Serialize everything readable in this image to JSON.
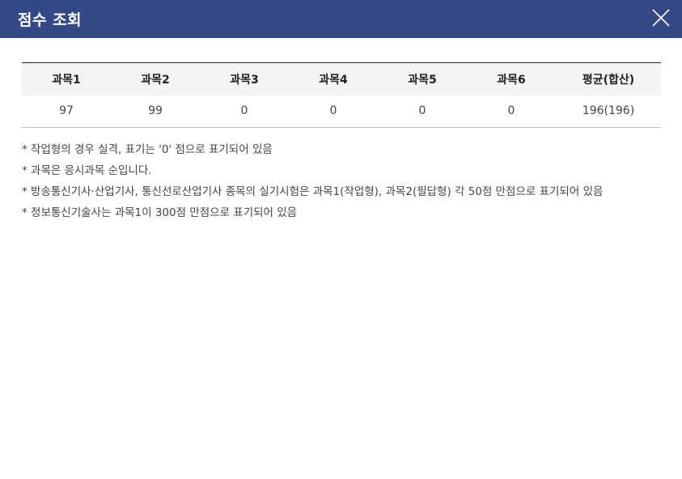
{
  "header": {
    "title": "점수 조회",
    "close_icon": "close-icon"
  },
  "table": {
    "headers": [
      "과목1",
      "과목2",
      "과목3",
      "과목4",
      "과목5",
      "과목6",
      "평균(합산)"
    ],
    "rows": [
      [
        "97",
        "99",
        "0",
        "0",
        "0",
        "0",
        "196(196)"
      ]
    ]
  },
  "notes": [
    "* 작업형의 경우 실격, 표기는 '0' 점으로 표기되어 있음",
    "* 과목은 응시과목 순입니다.",
    "* 방송통신기사·산업기사, 통신선로산업기사 종목의 실기시험은 과목1(작업형), 과목2(필답형) 각 50점 만점으로 표기되어 있음",
    "* 정보통신기술사는 과목1이 300점 만점으로 표기되어 있음"
  ],
  "colors": {
    "header_bg": "#354886",
    "header_text": "#ffffff",
    "table_head_bg": "#f3f3f3"
  }
}
